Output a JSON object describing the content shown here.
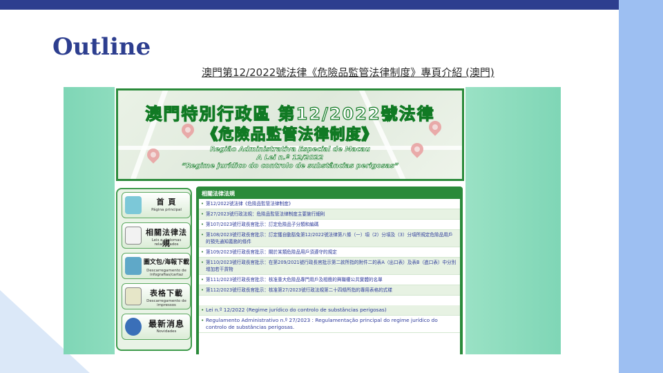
{
  "slide": {
    "title": "Outline",
    "link_text": "澳門第12/2022號法律《危險品監管法律制度》專頁介紹 (澳門)"
  },
  "banner": {
    "line1": "澳門特別行政區  第12/2022號法律",
    "line2": "《危險品監管法律制度》",
    "pt_line1": "Região Administrativa Especial de Macau",
    "pt_line2": "A Lei n.º 12/2022",
    "pt_line3": "“Regime jurídico do controlo de substâncias perigosas”"
  },
  "nav": {
    "items": [
      {
        "label": "首  頁",
        "sub": "Página principal",
        "icon": "home-monitor-icon"
      },
      {
        "label": "相關法律法規",
        "sub": "Leis e diplomas relacionados",
        "icon": "document-list-icon"
      },
      {
        "label": "圖文包/海報下載",
        "sub": "Descarregamento de infografias/cartaz",
        "icon": "poster-download-icon"
      },
      {
        "label": "表格下載",
        "sub": "Descarregamento de impressos",
        "icon": "form-download-icon"
      },
      {
        "label": "最新消息",
        "sub": "Novidades",
        "icon": "megaphone-icon"
      }
    ]
  },
  "content": {
    "heading": "相關法律法規",
    "items_zh": [
      "第12/2022號法律《危險品監管法律制度》",
      "第27/2023號行政法規：危險品監管法律制度主要施行細則",
      "第107/2023號行政長官批示：訂定危險品子分類和編碼",
      "第108/2023號行政長官批示：訂定獲自動豁免第12/2022號法律第八條（一）項（2）分項及（3）分項所規定危險品用戶的預先通知義務的條件",
      "第109/2023號行政長官批示：關於某類危險品用戶須遵守的規定",
      "第110/2023號行政長官批示：在第209/2021號行政長官批示第二款所指的附件二的表A（出口表）及表B（進口表）中分別增加若干貨物",
      "第111/2023號行政長官批示：核准重大危險品專門用戶及相應的興職權公共實體的名單",
      "第112/2023號行政長官批示：核准第27/2023號行政法規第二十四條所指的專用表格的式樣"
    ],
    "items_pt": [
      "Lei n.º 12/2022 (Regime jurídico do controlo de substâncias perigosas)",
      "Regulamento Administrativo n.º 27/2023 : Regulamentação principal do regime jurídico do controlo de substâncias perigosas."
    ]
  },
  "colors": {
    "title_blue": "#2d3e8f",
    "right_panel": "#9dbff2",
    "site_green": "#2a8a3a"
  }
}
